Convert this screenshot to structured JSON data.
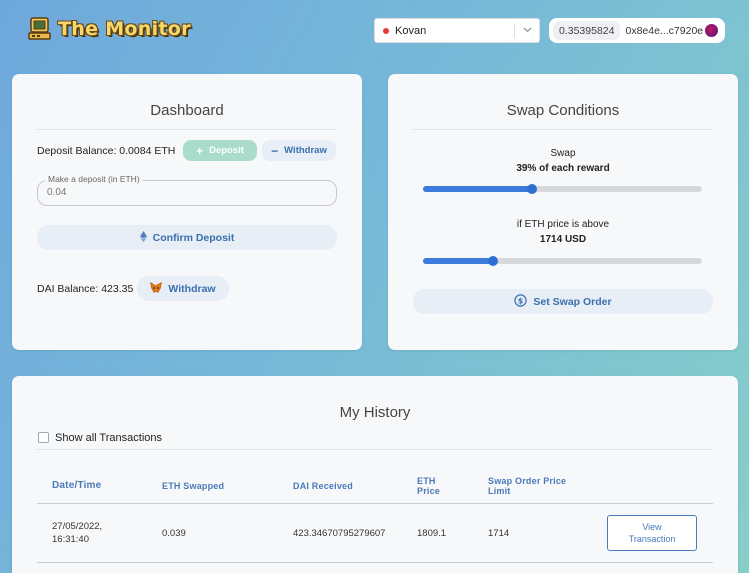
{
  "header": {
    "logo_text": "The Monitor",
    "network": {
      "label": "Kovan",
      "status_color": "#e53935"
    },
    "account": {
      "balance": "0.35395824",
      "address": "0x8e4e...c7920e"
    }
  },
  "dashboard": {
    "title": "Dashboard",
    "deposit_balance_label": "Deposit Balance: 0.0084 ETH",
    "deposit_button": "Deposit",
    "withdraw_button": "Withdraw",
    "deposit_input": {
      "legend": "Make a deposit (in ETH)",
      "value": "0.04"
    },
    "confirm_button": "Confirm Deposit",
    "dai_balance_label": "DAI Balance: 423.35",
    "dai_withdraw_button": "Withdraw"
  },
  "swap": {
    "title": "Swap Conditions",
    "swap_label": "Swap",
    "swap_value": "39% of each reward",
    "swap_percent": 0.39,
    "price_label": "if ETH price is above",
    "price_value": "1714 USD",
    "price_slider_fraction": 0.25,
    "set_order_button": "Set Swap Order"
  },
  "history": {
    "title": "My History",
    "show_all_label": "Show all Transactions",
    "show_all_checked": false,
    "columns": [
      "Date/Time",
      "ETH Swapped",
      "DAI Received",
      "ETH\nPrice",
      "Swap Order Price\nLimit"
    ],
    "rows": [
      {
        "date_line1": "27/05/2022,",
        "date_line2": "16:31:40",
        "eth_swapped": "0.039",
        "dai_received": "423.34670795279607",
        "eth_price": "1809.1",
        "price_limit": "1714",
        "action_line1": "View",
        "action_line2": "Transaction"
      }
    ]
  },
  "colors": {
    "accent": "#3b7bdc",
    "link": "#4a7ab8",
    "deposit_green": "#a9dccb"
  }
}
